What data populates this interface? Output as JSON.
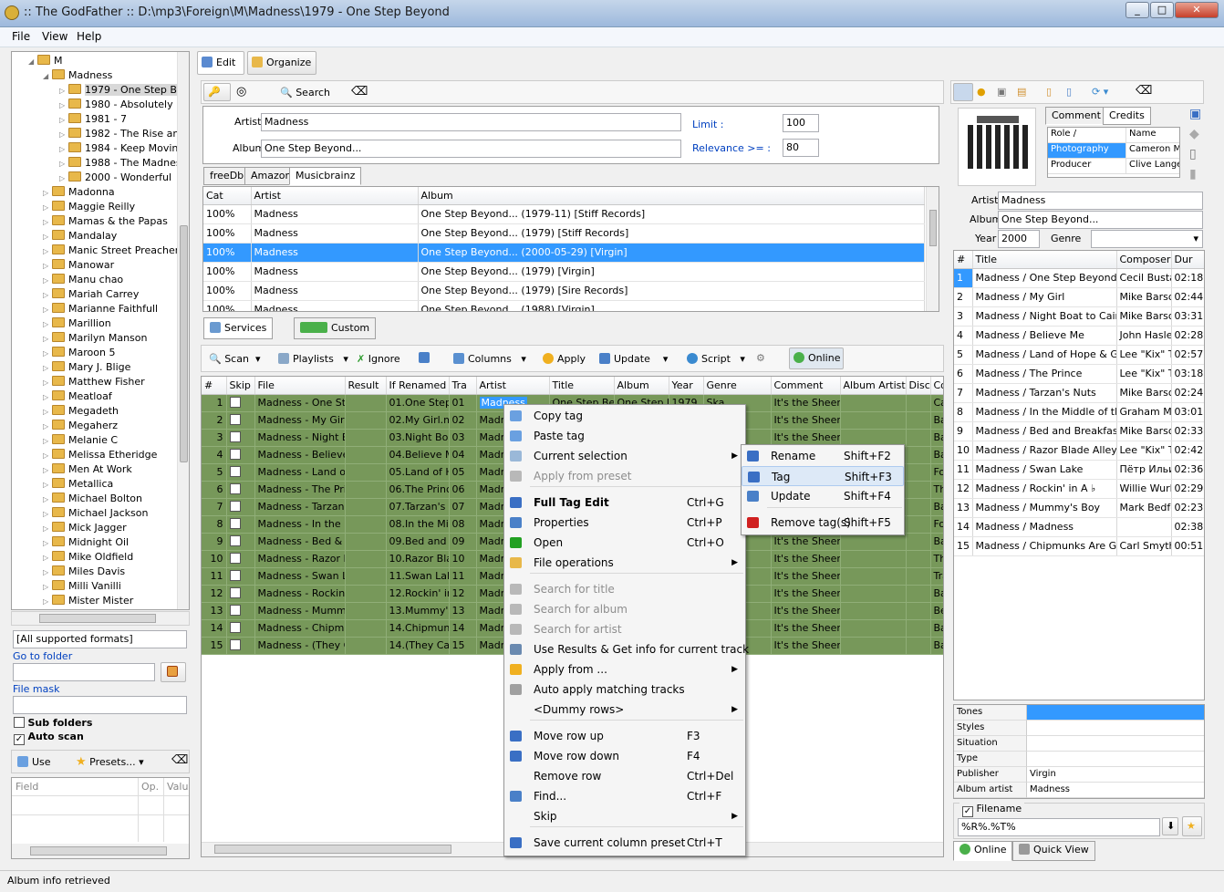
{
  "window": {
    "title": ":: The GodFather ::   D:\\mp3\\Foreign\\M\\Madness\\1979 - One Step Beyond"
  },
  "menu": [
    "File",
    "View",
    "Help"
  ],
  "tree": {
    "root": "M",
    "artist": "Madness",
    "albums": [
      "1979 - One Step Be",
      "1980 - Absolutely",
      "1981 - 7",
      "1982 - The Rise and",
      "1984 - Keep Moving",
      "1988 - The Madnes",
      "2000 - Wonderful"
    ],
    "others": [
      "Madonna",
      "Maggie Reilly",
      "Mamas & the Papas",
      "Mandalay",
      "Manic Street Preachers",
      "Manowar",
      "Manu chao",
      "Mariah Carrey",
      "Marianne Faithfull",
      "Marillion",
      "Marilyn Manson",
      "Maroon 5",
      "Mary J. Blige",
      "Matthew Fisher",
      "Meatloaf",
      "Megadeth",
      "Megaherz",
      "Melanie C",
      "Melissa Etheridge",
      "Men At Work",
      "Metallica",
      "Michael Bolton",
      "Michael Jackson",
      "Mick Jagger",
      "Midnight Oil",
      "Mike Oldfield",
      "Miles Davis",
      "Milli Vanilli",
      "Mister Mister"
    ]
  },
  "left": {
    "format": "[All supported formats]",
    "goto_folder": "Go to folder",
    "file_mask": "File mask",
    "sub_folders": "Sub folders",
    "auto_scan": "Auto scan",
    "use": "Use",
    "presets": "Presets...",
    "col_field": "Field",
    "col_op": "Op.",
    "col_value": "Value"
  },
  "top_tabs": {
    "edit": "Edit",
    "organize": "Organize"
  },
  "search": {
    "search_btn": "Search",
    "artist_label": "Artist",
    "artist_value": "Madness",
    "album_label": "Album",
    "album_value": "One Step Beyond...",
    "limit_label": "Limit :",
    "limit_value": "100",
    "relevance_label": "Relevance >= :",
    "relevance_value": "80"
  },
  "source_tabs": [
    "freeDb",
    "Amazon",
    "Musicbrainz"
  ],
  "results": {
    "headers": [
      "Cat",
      "Artist",
      "Album"
    ],
    "rows": [
      [
        "100%",
        "Madness",
        "One Step Beyond...  (1979-11)  [Stiff Records]"
      ],
      [
        "100%",
        "Madness",
        "One Step Beyond...  (1979)  [Stiff Records]"
      ],
      [
        "100%",
        "Madness",
        "One Step Beyond...  (2000-05-29)  [Virgin]"
      ],
      [
        "100%",
        "Madness",
        "One Step Beyond...  (1979)  [Virgin]"
      ],
      [
        "100%",
        "Madness",
        "One Step Beyond...  (1979)  [Sire Records]"
      ],
      [
        "100%",
        "Madness",
        "One Step Beyond...  (1988)  [Virgin]"
      ]
    ]
  },
  "services_tabs": {
    "services": "Services",
    "custom": "Custom"
  },
  "toolbar": {
    "scan": "Scan",
    "playlists": "Playlists",
    "ignore": "Ignore",
    "columns": "Columns",
    "apply": "Apply",
    "update": "Update",
    "script": "Script",
    "online": "Online"
  },
  "files": {
    "headers": [
      "#",
      "Skip",
      "File",
      "Result",
      "If Renamed",
      "Tra",
      "Artist",
      "Title",
      "Album",
      "Year",
      "Genre",
      "Comment",
      "Album Artist",
      "Disc",
      "Co"
    ],
    "rows": [
      [
        "1",
        "Madness - One Step",
        "01.One Step",
        "01",
        "Madness",
        "One Step Bey",
        "One Step B",
        "1979",
        "Ska",
        "It's the Sheer E",
        "Ca"
      ],
      [
        "2",
        "Madness - My Girl.m",
        "02.My Girl.mp",
        "02",
        "Madn",
        "",
        "",
        "",
        "",
        "It's the Sheer E",
        "Bar"
      ],
      [
        "3",
        "Madness - Night Bo",
        "03.Night Boa",
        "03",
        "Madn",
        "",
        "",
        "",
        "",
        "It's the Sheer E",
        "Bar"
      ],
      [
        "4",
        "Madness - Believe M",
        "04.Believe Me",
        "04",
        "Madn",
        "",
        "",
        "",
        "",
        "It's the Sheer E",
        "Bar"
      ],
      [
        "5",
        "Madness - Land of I",
        "05.Land of Ho",
        "05",
        "Madn",
        "",
        "",
        "",
        "",
        "It's the Sheer E",
        "For"
      ],
      [
        "6",
        "Madness - The Princ",
        "06.The Prince",
        "06",
        "Madn",
        "",
        "",
        "",
        "",
        "It's the Sheer E",
        "Tho"
      ],
      [
        "7",
        "Madness - Tarzan's",
        "07.Tarzan's N",
        "07",
        "Madn",
        "",
        "",
        "",
        "",
        "It's the Sheer E",
        "Bar"
      ],
      [
        "8",
        "Madness - In the M",
        "08.In the Mid",
        "08",
        "Madn",
        "",
        "",
        "",
        "",
        "It's the Sheer E",
        "For"
      ],
      [
        "9",
        "Madness - Bed & Br",
        "09.Bed and B",
        "09",
        "Madn",
        "",
        "",
        "",
        "",
        "It's the Sheer E",
        "Bar"
      ],
      [
        "10",
        "Madness - Razor Bla",
        "10.Razor Blac",
        "10",
        "Madn",
        "",
        "",
        "",
        "",
        "It's the Sheer E",
        "Tho"
      ],
      [
        "11",
        "Madness - Swan La",
        "11.Swan Lake",
        "11",
        "Madn",
        "",
        "",
        "",
        "",
        "It's the Sheer E",
        "Tra"
      ],
      [
        "12",
        "Madness - Rockin' in",
        "12.Rockin' in",
        "12",
        "Madn",
        "",
        "",
        "",
        "",
        "It's the Sheer E",
        "Bar"
      ],
      [
        "13",
        "Madness - Mummy's",
        "13.Mummy's I",
        "13",
        "Madn",
        "",
        "",
        "",
        "",
        "It's the Sheer E",
        "Bec"
      ],
      [
        "14",
        "Madness - Chipmun",
        "14.Chipmunk",
        "14",
        "Madn",
        "",
        "",
        "",
        "",
        "It's the Sheer E",
        "Bar"
      ],
      [
        "15",
        "Madness - (They Ca",
        "14.(They Call",
        "15",
        "Madn",
        "",
        "",
        "",
        "",
        "It's the Sheer E",
        "Bar"
      ]
    ]
  },
  "context_menu": {
    "items": [
      {
        "label": "Copy tag",
        "shortcut": "",
        "dis": false,
        "sub": false,
        "color": "#6aa0e0"
      },
      {
        "label": "Paste tag",
        "shortcut": "",
        "dis": false,
        "sub": false,
        "color": "#6aa0e0"
      },
      {
        "label": "Current selection",
        "shortcut": "",
        "dis": false,
        "sub": true,
        "color": "#9ab8d8"
      },
      {
        "label": "Apply from preset",
        "shortcut": "",
        "dis": true,
        "sub": false,
        "color": "#b8b8b8"
      },
      {
        "label": "Full Tag Edit",
        "shortcut": "Ctrl+G",
        "dis": false,
        "sub": false,
        "color": "#3a6fc4",
        "bold": true
      },
      {
        "label": "Properties",
        "shortcut": "Ctrl+P",
        "dis": false,
        "sub": false,
        "color": "#4a80c8"
      },
      {
        "label": "Open",
        "shortcut": "Ctrl+O",
        "dis": false,
        "sub": false,
        "color": "#22a022"
      },
      {
        "label": "File operations",
        "shortcut": "",
        "dis": false,
        "sub": true,
        "color": "#e8b84a"
      },
      {
        "label": "Search for title",
        "shortcut": "",
        "dis": true,
        "sub": false,
        "color": "#b8b8b8"
      },
      {
        "label": "Search for album",
        "shortcut": "",
        "dis": true,
        "sub": false,
        "color": "#b8b8b8"
      },
      {
        "label": "Search for artist",
        "shortcut": "",
        "dis": true,
        "sub": false,
        "color": "#b8b8b8"
      },
      {
        "label": "Use Results & Get info for current track",
        "shortcut": "",
        "dis": false,
        "sub": false,
        "color": "#6a8ab0"
      },
      {
        "label": "Apply from ...",
        "shortcut": "",
        "dis": false,
        "sub": true,
        "color": "#f0b020"
      },
      {
        "label": "Auto apply matching tracks",
        "shortcut": "",
        "dis": false,
        "sub": false,
        "color": "#a0a0a0"
      },
      {
        "label": "<Dummy rows>",
        "shortcut": "",
        "dis": false,
        "sub": true,
        "color": ""
      },
      {
        "label": "Move row up",
        "shortcut": "F3",
        "dis": false,
        "sub": false,
        "color": "#3a6fc4"
      },
      {
        "label": "Move row down",
        "shortcut": "F4",
        "dis": false,
        "sub": false,
        "color": "#3a6fc4"
      },
      {
        "label": "Remove row",
        "shortcut": "Ctrl+Del",
        "dis": false,
        "sub": false,
        "color": ""
      },
      {
        "label": "Find...",
        "shortcut": "Ctrl+F",
        "dis": false,
        "sub": false,
        "color": "#4a80c8"
      },
      {
        "label": "Skip",
        "shortcut": "",
        "dis": false,
        "sub": true,
        "color": ""
      },
      {
        "label": "Save current column preset",
        "shortcut": "Ctrl+T",
        "dis": false,
        "sub": false,
        "color": "#3a6fc4"
      }
    ]
  },
  "submenu": {
    "items": [
      {
        "label": "Rename",
        "shortcut": "Shift+F2",
        "color": "#3a6fc4"
      },
      {
        "label": "Tag",
        "shortcut": "Shift+F3",
        "color": "#3a6fc4"
      },
      {
        "label": "Update",
        "shortcut": "Shift+F4",
        "color": "#4a80c8"
      },
      {
        "label": "Remove tag(s)",
        "shortcut": "Shift+F5",
        "color": "#d02020"
      }
    ]
  },
  "right": {
    "tabs": [
      "Comment",
      "Credits"
    ],
    "credits_headers": [
      "Role /",
      "Name"
    ],
    "credits": [
      [
        "Photography",
        "Cameron Mc"
      ],
      [
        "Producer",
        "Clive Langer"
      ]
    ],
    "artist_label": "Artist",
    "artist_value": "Madness",
    "album_label": "Album",
    "album_value": "One Step Beyond...",
    "year_label": "Year",
    "year_value": "2000",
    "genre_label": "Genre",
    "track_headers": [
      "#",
      "Title",
      "Composer",
      "Dur"
    ],
    "tracks": [
      [
        "1",
        "Madness / One Step Beyond",
        "Cecil Bustar",
        "02:18"
      ],
      [
        "2",
        "Madness / My Girl",
        "Mike Barson",
        "02:44"
      ],
      [
        "3",
        "Madness / Night Boat to Cairo",
        "Mike Barson",
        "03:31"
      ],
      [
        "4",
        "Madness / Believe Me",
        "John Hasler",
        "02:28"
      ],
      [
        "5",
        "Madness / Land of Hope & Glory",
        "Lee \"Kix\" Th",
        "02:57"
      ],
      [
        "6",
        "Madness / The Prince",
        "Lee \"Kix\" Th",
        "03:18"
      ],
      [
        "7",
        "Madness / Tarzan's Nuts",
        "Mike Barson",
        "02:24"
      ],
      [
        "8",
        "Madness / In the Middle of the I",
        "Graham McI",
        "03:01"
      ],
      [
        "9",
        "Madness / Bed and Breakfast M",
        "Mike Barson",
        "02:33"
      ],
      [
        "10",
        "Madness / Razor Blade Alley",
        "Lee \"Kix\" Th",
        "02:42"
      ],
      [
        "11",
        "Madness / Swan Lake",
        "Пётр Ильич",
        "02:36"
      ],
      [
        "12",
        "Madness / Rockin' in A ♭",
        "Willie Wurlit",
        "02:29"
      ],
      [
        "13",
        "Madness / Mummy's Boy",
        "Mark Bedfor",
        "02:23"
      ],
      [
        "14",
        "Madness / Madness",
        "",
        "02:38"
      ],
      [
        "15",
        "Madness / Chipmunks Are Go!",
        "Carl Smyth",
        "00:51"
      ]
    ],
    "props": [
      [
        "Tones",
        ""
      ],
      [
        "Styles",
        ""
      ],
      [
        "Situation",
        ""
      ],
      [
        "Type",
        ""
      ],
      [
        "Publisher",
        "Virgin"
      ],
      [
        "Album artist",
        "Madness"
      ]
    ],
    "filename_label": "Filename",
    "filename_value": "%R%.%T%",
    "bottom_tabs": [
      "Online",
      "Quick View"
    ]
  },
  "status": "Album info retrieved"
}
